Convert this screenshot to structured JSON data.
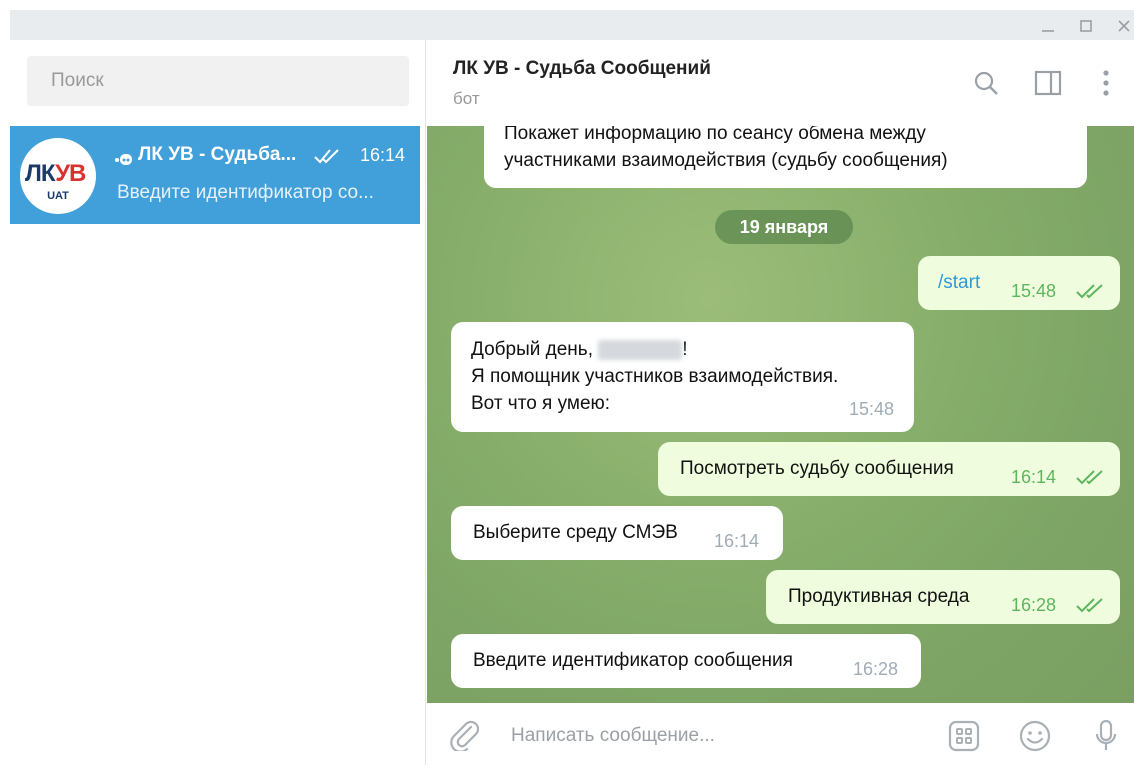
{
  "window": {
    "minimize_icon": "minimize-icon",
    "maximize_icon": "maximize-icon",
    "close_icon": "close-icon"
  },
  "sidebar": {
    "search_placeholder": "Поиск",
    "chats": [
      {
        "name": "ЛК УВ - Судьба...",
        "time": "16:14",
        "preview": "Введите идентификатор со...",
        "avatar_text_lk": "ЛК",
        "avatar_text_uv": "УВ",
        "avatar_subtext": "UAT",
        "selected": true,
        "is_bot": true
      }
    ]
  },
  "header": {
    "title": "ЛК УВ - Судьба Сообщений",
    "subtitle": "бот"
  },
  "messages": [
    {
      "direction": "in",
      "text_line1": "Покажет информацию по сеансу обмена между",
      "text_line2": "участниками взаимодействия (судьбу сообщения)"
    },
    {
      "type": "date",
      "text": "19 января"
    },
    {
      "direction": "out",
      "text": "/start",
      "time": "15:48",
      "read": true
    },
    {
      "direction": "in",
      "greeting_prefix": "Добрый день, ",
      "greeting_suffix": "!",
      "line2": "Я помощник участников взаимодействия.",
      "line3": "Вот что я умею:",
      "time": "15:48"
    },
    {
      "direction": "out",
      "text": "Посмотреть судьбу сообщения",
      "time": "16:14",
      "read": true
    },
    {
      "direction": "in",
      "text": "Выберите среду СМЭВ",
      "time": "16:14"
    },
    {
      "direction": "out",
      "text": "Продуктивная среда",
      "time": "16:28",
      "read": true
    },
    {
      "direction": "in",
      "text": "Введите идентификатор сообщения",
      "time": "16:28"
    }
  ],
  "composer": {
    "placeholder": "Написать сообщение..."
  },
  "colors": {
    "accent": "#419fd9",
    "titlebar": "#e9ecef",
    "out_bubble": "#effdde",
    "out_meta": "#5eb55e",
    "link": "#2e9ad7"
  }
}
